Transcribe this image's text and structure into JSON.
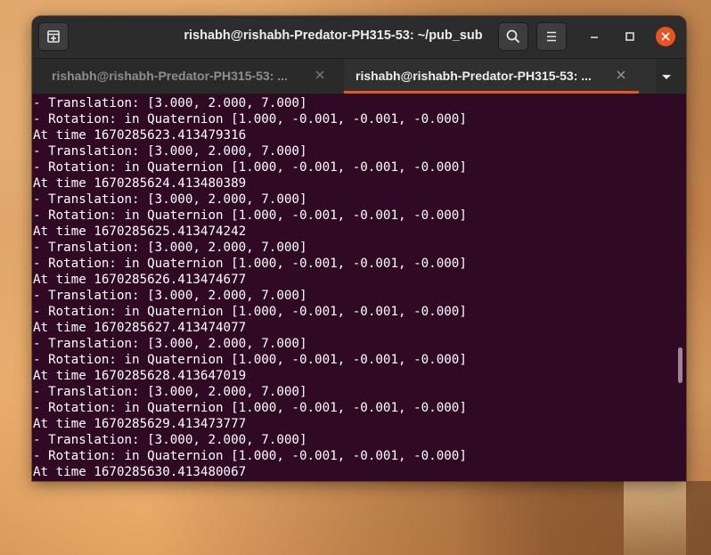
{
  "window": {
    "title": "rishabh@rishabh-Predator-PH315-53: ~/pub_sub"
  },
  "tabs": [
    {
      "label": "rishabh@rishabh-Predator-PH315-53: ...",
      "active": false
    },
    {
      "label": "rishabh@rishabh-Predator-PH315-53: ...",
      "active": true
    }
  ],
  "icons": {
    "new_tab": "new-tab-icon",
    "search": "search-icon",
    "menu": "hamburger-menu-icon",
    "minimize": "minimize-icon",
    "maximize": "maximize-icon",
    "close": "close-icon",
    "tab_close": "close-icon",
    "tabs_dropdown": "chevron-down-icon"
  },
  "colors": {
    "accent": "#e95420",
    "terminal_background": "#300a24",
    "terminal_text": "#ffffff",
    "headerbar": "#2c2c2c"
  },
  "terminal": {
    "scroll_fraction": 0.72,
    "lines": [
      "- Translation: [3.000, 2.000, 7.000]",
      "- Rotation: in Quaternion [1.000, -0.001, -0.001, -0.000]",
      "At time 1670285623.413479316",
      "- Translation: [3.000, 2.000, 7.000]",
      "- Rotation: in Quaternion [1.000, -0.001, -0.001, -0.000]",
      "At time 1670285624.413480389",
      "- Translation: [3.000, 2.000, 7.000]",
      "- Rotation: in Quaternion [1.000, -0.001, -0.001, -0.000]",
      "At time 1670285625.413474242",
      "- Translation: [3.000, 2.000, 7.000]",
      "- Rotation: in Quaternion [1.000, -0.001, -0.001, -0.000]",
      "At time 1670285626.413474677",
      "- Translation: [3.000, 2.000, 7.000]",
      "- Rotation: in Quaternion [1.000, -0.001, -0.001, -0.000]",
      "At time 1670285627.413474077",
      "- Translation: [3.000, 2.000, 7.000]",
      "- Rotation: in Quaternion [1.000, -0.001, -0.001, -0.000]",
      "At time 1670285628.413647019",
      "- Translation: [3.000, 2.000, 7.000]",
      "- Rotation: in Quaternion [1.000, -0.001, -0.001, -0.000]",
      "At time 1670285629.413473777",
      "- Translation: [3.000, 2.000, 7.000]",
      "- Rotation: in Quaternion [1.000, -0.001, -0.001, -0.000]",
      "At time 1670285630.413480067"
    ]
  }
}
